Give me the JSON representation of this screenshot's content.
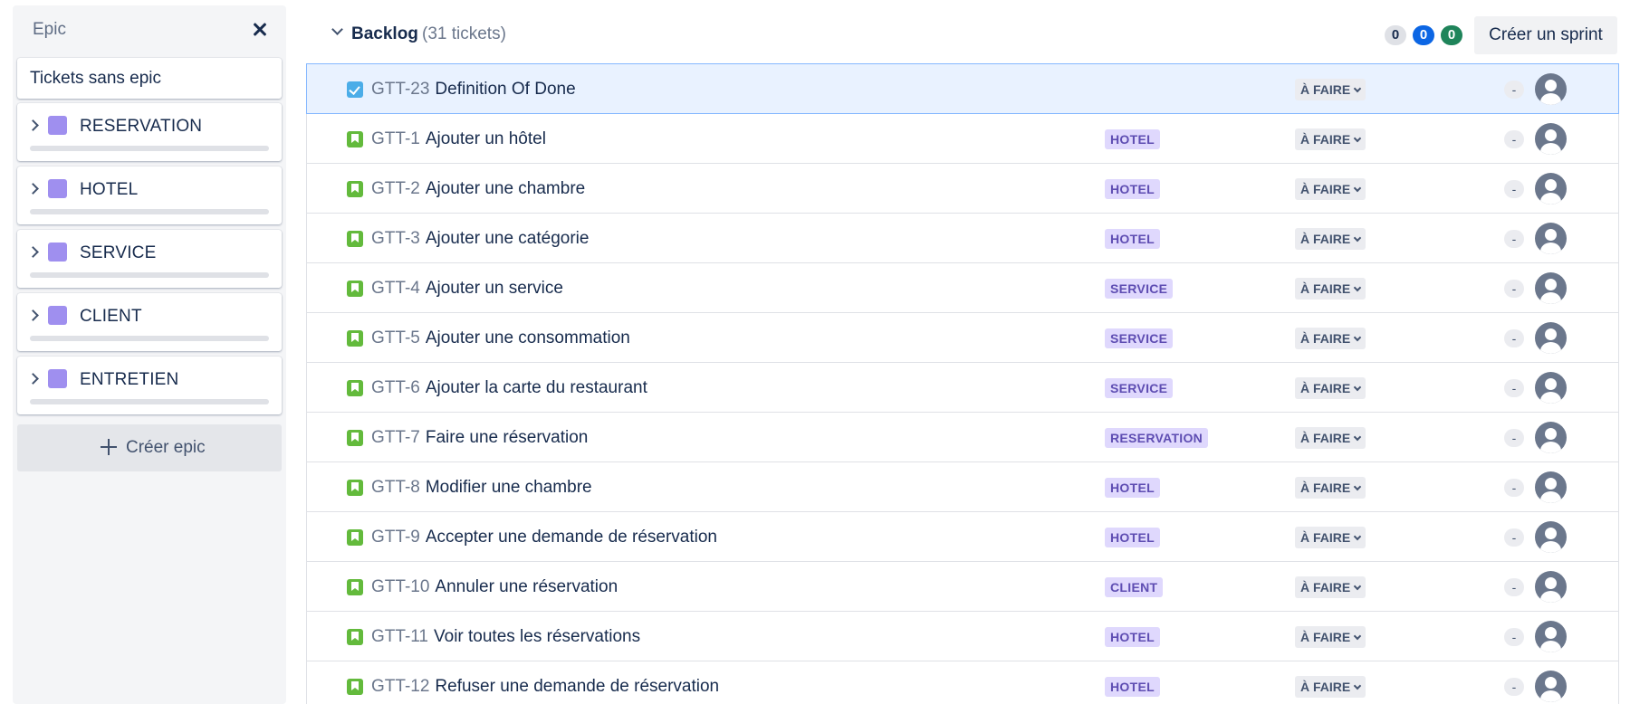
{
  "epic_panel": {
    "title": "Epic",
    "no_epic_label": "Tickets sans epic",
    "epics": [
      {
        "name": "RESERVATION",
        "color": "#9f8fef"
      },
      {
        "name": "HOTEL",
        "color": "#9f8fef"
      },
      {
        "name": "SERVICE",
        "color": "#9f8fef"
      },
      {
        "name": "CLIENT",
        "color": "#9f8fef"
      },
      {
        "name": "ENTRETIEN",
        "color": "#9f8fef"
      }
    ],
    "create_label": "Créer epic"
  },
  "backlog": {
    "title": "Backlog",
    "count": "(31 tickets)",
    "status_counts": {
      "todo": "0",
      "in_progress": "0",
      "done": "0"
    },
    "create_sprint_label": "Créer un sprint",
    "issues": [
      {
        "key": "GTT-23",
        "summary": "Definition Of Done",
        "type": "task",
        "epic": "",
        "status": "À FAIRE",
        "estimate": "-",
        "selected": true
      },
      {
        "key": "GTT-1",
        "summary": "Ajouter un hôtel",
        "type": "story",
        "epic": "HOTEL",
        "status": "À FAIRE",
        "estimate": "-"
      },
      {
        "key": "GTT-2",
        "summary": "Ajouter une chambre",
        "type": "story",
        "epic": "HOTEL",
        "status": "À FAIRE",
        "estimate": "-"
      },
      {
        "key": "GTT-3",
        "summary": "Ajouter une catégorie",
        "type": "story",
        "epic": "HOTEL",
        "status": "À FAIRE",
        "estimate": "-"
      },
      {
        "key": "GTT-4",
        "summary": "Ajouter un service",
        "type": "story",
        "epic": "SERVICE",
        "status": "À FAIRE",
        "estimate": "-"
      },
      {
        "key": "GTT-5",
        "summary": "Ajouter une consommation",
        "type": "story",
        "epic": "SERVICE",
        "status": "À FAIRE",
        "estimate": "-"
      },
      {
        "key": "GTT-6",
        "summary": "Ajouter la carte du restaurant",
        "type": "story",
        "epic": "SERVICE",
        "status": "À FAIRE",
        "estimate": "-"
      },
      {
        "key": "GTT-7",
        "summary": "Faire une réservation",
        "type": "story",
        "epic": "RESERVATION",
        "status": "À FAIRE",
        "estimate": "-"
      },
      {
        "key": "GTT-8",
        "summary": "Modifier une chambre",
        "type": "story",
        "epic": "HOTEL",
        "status": "À FAIRE",
        "estimate": "-"
      },
      {
        "key": "GTT-9",
        "summary": "Accepter une demande de réservation",
        "type": "story",
        "epic": "HOTEL",
        "status": "À FAIRE",
        "estimate": "-"
      },
      {
        "key": "GTT-10",
        "summary": "Annuler une réservation",
        "type": "story",
        "epic": "CLIENT",
        "status": "À FAIRE",
        "estimate": "-"
      },
      {
        "key": "GTT-11",
        "summary": "Voir toutes les réservations",
        "type": "story",
        "epic": "HOTEL",
        "status": "À FAIRE",
        "estimate": "-"
      },
      {
        "key": "GTT-12",
        "summary": "Refuser une demande de réservation",
        "type": "story",
        "epic": "HOTEL",
        "status": "À FAIRE",
        "estimate": "-"
      }
    ]
  }
}
